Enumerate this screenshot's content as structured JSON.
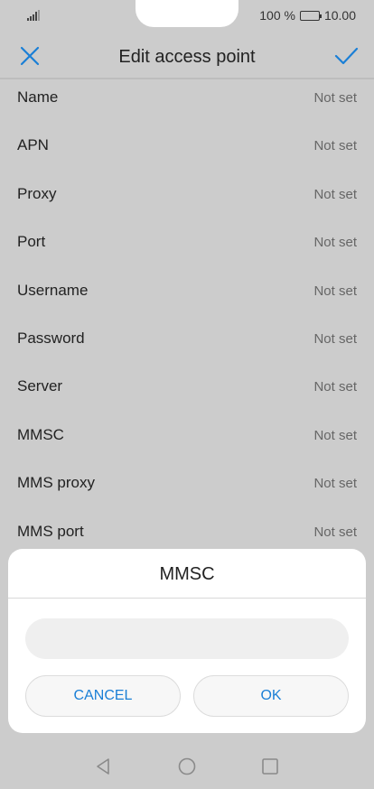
{
  "status_bar": {
    "battery_text": "100 %",
    "time": "10.00",
    "battery_level": 1.0
  },
  "app_bar": {
    "title": "Edit access point",
    "close_icon": "close-icon",
    "confirm_icon": "check-icon"
  },
  "settings": [
    {
      "label": "Name",
      "value": "Not set"
    },
    {
      "label": "APN",
      "value": "Not set"
    },
    {
      "label": "Proxy",
      "value": "Not set"
    },
    {
      "label": "Port",
      "value": "Not set"
    },
    {
      "label": "Username",
      "value": "Not set"
    },
    {
      "label": "Password",
      "value": "Not set"
    },
    {
      "label": "Server",
      "value": "Not set"
    },
    {
      "label": "MMSC",
      "value": "Not set"
    },
    {
      "label": "MMS proxy",
      "value": "Not set"
    },
    {
      "label": "MMS port",
      "value": "Not set"
    }
  ],
  "dialog": {
    "title": "MMSC",
    "input_value": "",
    "cancel_label": "CANCEL",
    "ok_label": "OK"
  },
  "colors": {
    "accent": "#1a7fd6",
    "scrim": "#cccccc"
  }
}
